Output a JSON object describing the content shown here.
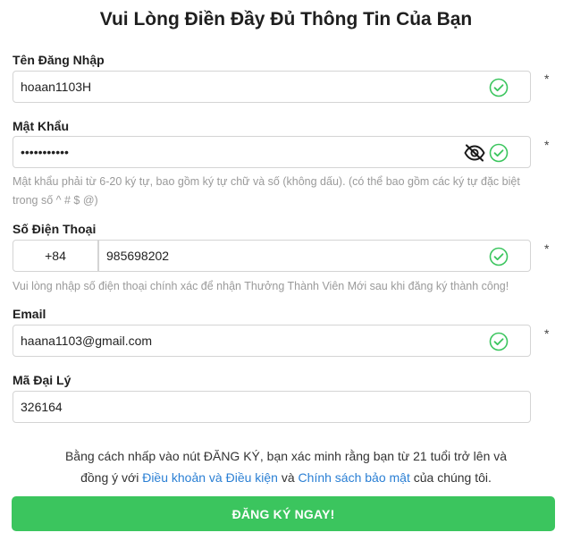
{
  "form": {
    "title": "Vui Lòng Điền Đầy Đủ Thông Tin Của Bạn",
    "required_mark": "*",
    "username": {
      "label": "Tên Đăng Nhập",
      "value": "hoaan1103H",
      "status_icon": "check-circle-icon"
    },
    "password": {
      "label": "Mật Khẩu",
      "value": "•••••••••••",
      "hint": "Mật khẩu phải từ 6-20 ký tự, bao gồm ký tự chữ và số (không dấu). (có thể bao gồm các ký tự đặc biệt trong số ^ # $ @)",
      "toggle_icon": "eye-slash-icon",
      "status_icon": "check-circle-icon"
    },
    "phone": {
      "label": "Số Điện Thoại",
      "country_code": "+84",
      "value": "985698202",
      "hint": "Vui lòng nhập số điện thoại chính xác để nhận Thưởng Thành Viên Mới sau khi đăng ký thành công!",
      "status_icon": "check-circle-icon"
    },
    "email": {
      "label": "Email",
      "value": "haana1103@gmail.com",
      "status_icon": "check-circle-icon"
    },
    "agent_code": {
      "label": "Mã Đại Lý",
      "value": "326164"
    },
    "terms": {
      "line1": "Bằng cách nhấp vào nút ĐĂNG KÝ, bạn xác minh rằng bạn từ 21 tuổi trở lên và",
      "prefix2": "đồng ý với",
      "terms_link": "Điều khoản và Điều kiện",
      "and": "và",
      "privacy_link": "Chính sách bảo mật",
      "suffix": "của chúng tôi."
    },
    "submit_label": "ĐĂNG KÝ NGAY!"
  },
  "colors": {
    "success": "#3bc55e",
    "link": "#2a7fd4",
    "hint": "#9a9a9a",
    "border": "#d4d4d4"
  }
}
